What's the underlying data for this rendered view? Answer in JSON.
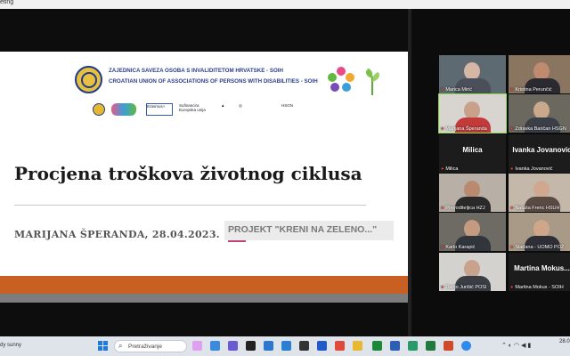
{
  "window": {
    "title": "eting"
  },
  "slide": {
    "org_line1": "ZAJEDNICA SAVEZA OSOBA S INVALIDITETOM HRVATSKE - SOIH",
    "org_line2": "CROATIAN UNION OF ASSOCIATIONS OF PERSONS WITH DISABILITIES - SOIH",
    "partner_logos": [
      "Erasmus+",
      "Sufinancira Europska unija",
      "HSGN"
    ],
    "title": "Procjena troškova životnog ciklusa",
    "author_date": "MARIJANA ŠPERANDA, 28.04.2023.",
    "project": "PROJEKT \"KRENI NA ZELENO...\"",
    "colors": {
      "band_orange": "#c95f22",
      "band_gray": "#7d7d7d",
      "org_text": "#2c3e8c"
    }
  },
  "participants": [
    {
      "name": "Marica Mirić",
      "big": ""
    },
    {
      "name": "Kristina Perunčić",
      "big": ""
    },
    {
      "name": "Marijana Šperanda",
      "big": ""
    },
    {
      "name": "Zdravka Baričan HSGN",
      "big": ""
    },
    {
      "name": "Milica",
      "big": "Milica"
    },
    {
      "name": "Ivanka Jovanović",
      "big": "Ivanka Jovanovic"
    },
    {
      "name": "Prevoditeljica HZJ",
      "big": ""
    },
    {
      "name": "Nataša Frenc HSUH",
      "big": ""
    },
    {
      "name": "Karlo Karapić",
      "big": ""
    },
    {
      "name": "Slađana - UOMO POŽ",
      "big": ""
    },
    {
      "name": "Darijo Jurišić POSI",
      "big": ""
    },
    {
      "name": "Martina Mokus - SOIH",
      "big": "Martina  Mokus..."
    }
  ],
  "taskbar": {
    "weather": "dy sunny",
    "search_placeholder": "Pretraživanje",
    "clock": "28.0"
  }
}
